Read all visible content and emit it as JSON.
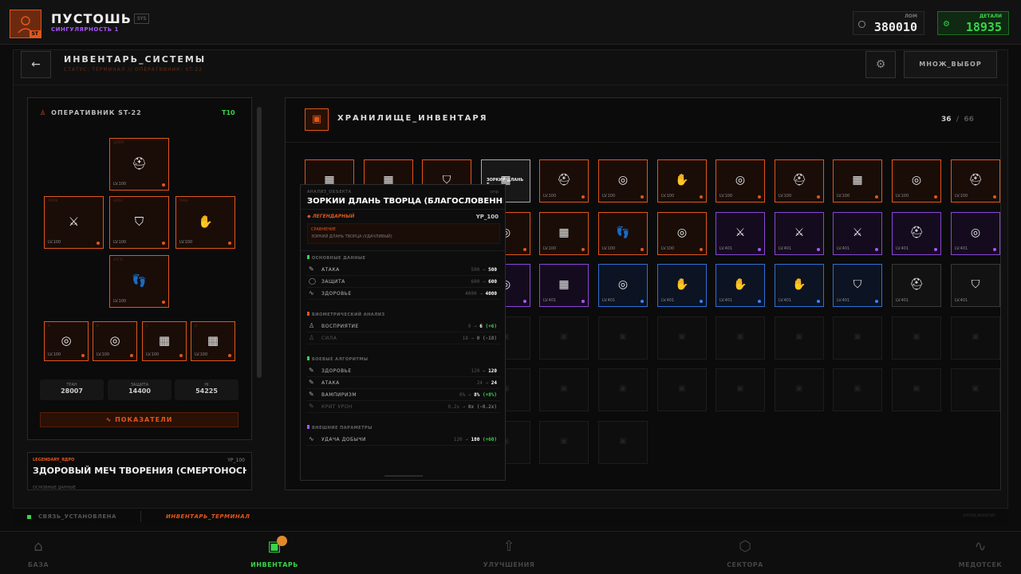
{
  "header": {
    "player_name": "ПУСТОШЬ",
    "tag": "SYS",
    "subtitle": "СИНГУЛЯРНОСТЬ 1",
    "avatar_level": "ST",
    "currency_1": {
      "label": "ЛОМ",
      "value": "380010"
    },
    "currency_2": {
      "label": "ДЕТАЛИ",
      "value": "18935",
      "icon": "gear-icon"
    },
    "accent": "#e0561b",
    "green": "#39d34b"
  },
  "page": {
    "title": "ИНВЕНТАРЬ_СИСТЕМЫ",
    "status": "СТАТУС: ТЕРМИНАЛ // ОПЕРАТИВНИК: ST-22",
    "multi_select": "МНОЖ_ВЫБОР"
  },
  "operative": {
    "title": "ОПЕРАТИВНИК ST-22",
    "tier": "T10",
    "slots": [
      {
        "slot": "ШЛЕМ",
        "icon": "helmet-icon",
        "level": "LV.100"
      },
      {
        "slot": "ОРУЖ",
        "icon": "sword-icon",
        "level": "LV.100"
      },
      {
        "slot": "БРОН",
        "icon": "shield-icon",
        "level": "LV.100"
      },
      {
        "slot": "РУКИ",
        "icon": "hand-icon",
        "level": "LV.100"
      },
      {
        "slot": "НОГИ",
        "icon": "boots-icon",
        "level": "LV.100"
      },
      {
        "slot": "A",
        "icon": "ring-icon",
        "level": "LV.100"
      },
      {
        "slot": "B",
        "icon": "ring-icon",
        "level": "LV.100"
      },
      {
        "slot": "C",
        "icon": "chip-icon",
        "level": "LV.100"
      },
      {
        "slot": "D",
        "icon": "chip-icon",
        "level": "LV.100"
      }
    ],
    "stats": [
      {
        "label": "ТРАН",
        "value": "28007"
      },
      {
        "label": "ЗАЩИТА",
        "value": "14400"
      },
      {
        "label": "HI",
        "value": "54225"
      }
    ],
    "metrics_button": "ПОКАЗАТЕЛИ"
  },
  "lower_card": {
    "tag": "LEGENDARY_ЯДРО",
    "level": "YP_100",
    "name": "ЗДОРОВЫЙ МЕЧ ТВОРЕНИЯ (СМЕРТОНОСНЫЙ)",
    "section": "ОСНОВНЫЕ ДАННЫЕ"
  },
  "storage": {
    "title": "ХРАНИЛИЩЕ_ИНВЕНТАРЯ",
    "count": "36",
    "capacity": "66",
    "rows": [
      [
        {
          "rarity": "o",
          "icon": "chip-icon",
          "level": "LV.100"
        },
        {
          "rarity": "o",
          "icon": "chip-icon",
          "level": "LV.100"
        },
        {
          "rarity": "o",
          "icon": "shield-icon",
          "level": "LV.100"
        },
        {
          "rarity": "w",
          "icon": "chip-icon",
          "level": "",
          "name": "ЗОРКИЙ ДЛАНЬ Т..."
        },
        {
          "rarity": "o",
          "icon": "helmet-icon",
          "level": "LV.100"
        },
        {
          "rarity": "o",
          "icon": "ring-icon",
          "level": "LV.100"
        },
        {
          "rarity": "o",
          "icon": "hand-icon",
          "level": "LV.100"
        },
        {
          "rarity": "o",
          "icon": "ring-icon",
          "level": "LV.100"
        },
        {
          "rarity": "o",
          "icon": "helmet-icon",
          "level": "LV.100"
        },
        {
          "rarity": "o",
          "icon": "chip-icon",
          "level": "LV.100"
        },
        {
          "rarity": "o",
          "icon": "ring-icon",
          "level": "LV.100"
        },
        {
          "rarity": "o",
          "icon": "helmet-icon",
          "level": "LV.100"
        }
      ],
      [
        {
          "rarity": "o",
          "icon": "ring-icon",
          "level": "LV.100"
        },
        {
          "rarity": "o",
          "icon": "ring-icon",
          "level": "LV.100"
        },
        {
          "rarity": "o",
          "icon": "ring-icon",
          "level": "LV.100"
        },
        {
          "rarity": "o",
          "icon": "ring-icon",
          "level": "LV.100"
        },
        {
          "rarity": "o",
          "icon": "chip-icon",
          "level": "LV.100"
        },
        {
          "rarity": "o",
          "icon": "boots-icon",
          "level": "LV.100"
        },
        {
          "rarity": "o",
          "icon": "ring-icon",
          "level": "LV.100"
        },
        {
          "rarity": "p",
          "icon": "sword-icon",
          "level": "LV.401"
        },
        {
          "rarity": "p",
          "icon": "sword-icon",
          "level": "LV.401"
        },
        {
          "rarity": "p",
          "icon": "sword-icon",
          "level": "LV.401"
        },
        {
          "rarity": "p",
          "icon": "helmet-icon",
          "level": "LV.401"
        },
        {
          "rarity": "p",
          "icon": "ring-icon",
          "level": "LV.401"
        }
      ],
      [
        {
          "rarity": "p",
          "icon": "ring-icon",
          "level": "LV.401"
        },
        {
          "rarity": "p",
          "icon": "ring-icon",
          "level": "LV.401"
        },
        {
          "rarity": "p",
          "icon": "ring-icon",
          "level": "LV.401"
        },
        {
          "rarity": "p",
          "icon": "ring-icon",
          "level": "LV.401"
        },
        {
          "rarity": "p",
          "icon": "chip-icon",
          "level": "LV.401"
        },
        {
          "rarity": "b",
          "icon": "ring-icon",
          "level": "LV.401"
        },
        {
          "rarity": "b",
          "icon": "hand-icon",
          "level": "LV.401"
        },
        {
          "rarity": "b",
          "icon": "hand-icon",
          "level": "LV.401"
        },
        {
          "rarity": "b",
          "icon": "hand-icon",
          "level": "LV.401"
        },
        {
          "rarity": "b",
          "icon": "shield-icon",
          "level": "LV.401"
        },
        {
          "rarity": "g",
          "icon": "helmet-icon",
          "level": "LV.401"
        },
        {
          "rarity": "g",
          "icon": "shield-icon",
          "level": "LV.401"
        }
      ]
    ],
    "empty_rows": 3
  },
  "tooltip": {
    "label": "АНАЛИЗ_ОБЪЕКТА",
    "label_right": "cmp",
    "name": "ЗОРКИЙ ДЛАНЬ ТВОРЦА (БЛАГОСЛОВЕННЫЙ)",
    "rarity": "ЛЕГЕНДАРНЫЙ",
    "level": "YP_100",
    "compare_label": "СРАВНЕНИЕ",
    "compare_item": "ЗОРКИЙ ДЛАНЬ ТВОРЦА (УДАЧЛИВЫЙ)",
    "sections": [
      {
        "title": "ОСНОВНЫЕ ДАННЫЕ",
        "color": "#39d34b",
        "rows": [
          {
            "icon": "✎",
            "label": "АТАКА",
            "from": "500",
            "to": "500",
            "delta": "",
            "dim": false
          },
          {
            "icon": "◯",
            "label": "ЗАЩИТА",
            "from": "600",
            "to": "600",
            "delta": "",
            "dim": false
          },
          {
            "icon": "∿",
            "label": "ЗДОРОВЬЕ",
            "from": "4000",
            "to": "4000",
            "delta": "",
            "dim": false
          }
        ]
      },
      {
        "title": "БИОМЕТРИЧЕСКИЙ АНАЛИЗ",
        "color": "#e0561b",
        "rows": [
          {
            "icon": "♙",
            "label": "ВОСПРИЯТИЕ",
            "from": "0",
            "to": "6",
            "delta": "(+6)",
            "dim": false
          },
          {
            "icon": "♙",
            "label": "СИЛА",
            "from": "18",
            "to": "0",
            "delta": "(-18)",
            "dim": true
          }
        ]
      },
      {
        "title": "БОЕВЫЕ АЛГОРИТМЫ",
        "color": "#39d34b",
        "rows": [
          {
            "icon": "✎",
            "label": "ЗДОРОВЬЕ",
            "from": "120",
            "to": "120",
            "delta": "",
            "dim": false
          },
          {
            "icon": "✎",
            "label": "АТАКА",
            "from": "24",
            "to": "24",
            "delta": "",
            "dim": false
          },
          {
            "icon": "✎",
            "label": "ВАМПИРИЗМ",
            "from": "0%",
            "to": "8%",
            "delta": "(+8%)",
            "dim": false
          },
          {
            "icon": "✎",
            "label": "КРИТ УРОН",
            "from": "0.2x",
            "to": "0x",
            "delta": "(-0.2x)",
            "dim": true
          }
        ]
      },
      {
        "title": "ВНЕШНИЕ ПАРАМЕТРЫ",
        "color": "#a855f7",
        "rows": [
          {
            "icon": "∿",
            "label": "УДАЧА ДОБЫЧИ",
            "from": "120",
            "to": "180",
            "delta": "(+60)",
            "dim": false
          }
        ]
      }
    ]
  },
  "statusbar": {
    "link": "СВЯЗЬ_УСТАНОВЛЕНА",
    "terminal": "ИНВЕНТАРЬ_ТЕРМИНАЛ",
    "right": "SYSTEM_INVENTORY"
  },
  "nav": [
    {
      "label": "БАЗА",
      "icon": "home-icon",
      "active": false
    },
    {
      "label": "ИНВЕНТАРЬ",
      "icon": "box-icon",
      "active": true
    },
    {
      "label": "УЛУЧШЕНИЯ",
      "icon": "upgrade-icon",
      "active": false
    },
    {
      "label": "СЕКТОРА",
      "icon": "hexagon-icon",
      "active": false
    },
    {
      "label": "МЕДОТСЕК",
      "icon": "pulse-icon",
      "active": false
    }
  ]
}
